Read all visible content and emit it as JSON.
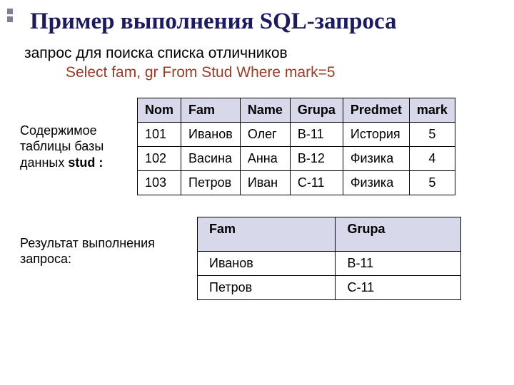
{
  "title": "Пример выполнения SQL-запроса",
  "intro": "запрос для поиска списка отличников",
  "sql": "Select fam, gr  From Stud  Where mark=5",
  "source_label_1": "Содержимое таблицы базы данных ",
  "source_label_2": "stud :",
  "source_table": {
    "headers": [
      "Nom",
      "Fam",
      "Name",
      "Grupa",
      "Predmet",
      "mark"
    ],
    "rows": [
      [
        "101",
        "Иванов",
        "Олег",
        "В-11",
        "История",
        "5"
      ],
      [
        "102",
        "Васина",
        "Анна",
        "В-12",
        "Физика",
        "4"
      ],
      [
        "103",
        "Петров",
        "Иван",
        "С-11",
        "Физика",
        "5"
      ]
    ]
  },
  "result_label": "Результат выполнения запроса:",
  "result_table": {
    "headers": [
      "Fam",
      "Grupa"
    ],
    "rows": [
      [
        "Иванов",
        "В-11"
      ],
      [
        "Петров",
        "С-11"
      ]
    ]
  },
  "chart_data": {
    "type": "table",
    "title": "Пример выполнения SQL-запроса",
    "source": {
      "columns": [
        "Nom",
        "Fam",
        "Name",
        "Grupa",
        "Predmet",
        "mark"
      ],
      "rows": [
        {
          "Nom": 101,
          "Fam": "Иванов",
          "Name": "Олег",
          "Grupa": "В-11",
          "Predmet": "История",
          "mark": 5
        },
        {
          "Nom": 102,
          "Fam": "Васина",
          "Name": "Анна",
          "Grupa": "В-12",
          "Predmet": "Физика",
          "mark": 4
        },
        {
          "Nom": 103,
          "Fam": "Петров",
          "Name": "Иван",
          "Grupa": "С-11",
          "Predmet": "Физика",
          "mark": 5
        }
      ]
    },
    "query": "Select fam, gr From Stud Where mark=5",
    "result": {
      "columns": [
        "Fam",
        "Grupa"
      ],
      "rows": [
        {
          "Fam": "Иванов",
          "Grupa": "В-11"
        },
        {
          "Fam": "Петров",
          "Grupa": "С-11"
        }
      ]
    }
  }
}
